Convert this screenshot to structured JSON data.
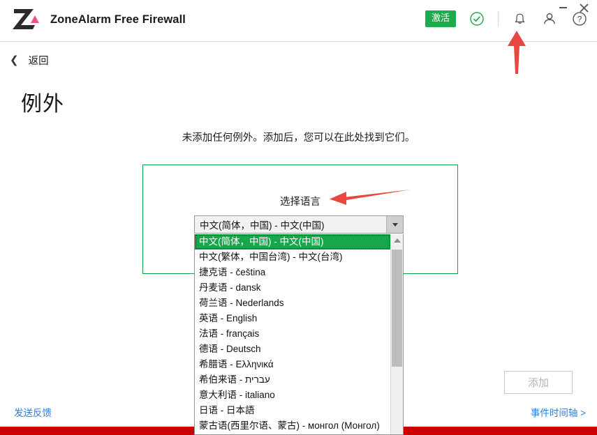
{
  "window": {
    "app_title": "ZoneAlarm Free Firewall",
    "minimize_label": "",
    "close_label": "✕"
  },
  "header": {
    "activate_label": "激活",
    "status_icon": "check-circle-icon",
    "notifications_icon": "bell-icon",
    "account_icon": "person-icon",
    "help_icon": "help-icon",
    "accent_green": "#1faa4d"
  },
  "nav": {
    "back_label": "返回",
    "back_icon": "chevron-left-icon"
  },
  "page": {
    "title": "例外",
    "empty_message": "未添加任何例外。添加后，您可以在此处找到它们。"
  },
  "language_panel": {
    "heading": "选择语言",
    "panel_border_color": "#13a04a",
    "combo_value": "中文(简体，中国) - 中文(中国)",
    "combo_arrow_icon": "chevron-down-icon",
    "selected_index": 0,
    "highlight_color": "#14a84b",
    "options": [
      "中文(简体，中国) - 中文(中国)",
      "中文(繁体，中国台湾) - 中文(台湾)",
      "捷克语 - čeština",
      "丹麦语 - dansk",
      "荷兰语 - Nederlands",
      "英语 - English",
      "法语 - français",
      "德语 - Deutsch",
      "希腊语 - Ελληνικά",
      "希伯来语 - עברית",
      "意大利语 - italiano",
      "日语 - 日本語",
      "蒙古语(西里尔语、蒙古) - монгол (Монгол)"
    ]
  },
  "annotations": {
    "arrow_color": "#e8483f",
    "arrow_language_target": "选择语言",
    "arrow_account_target": "person-icon"
  },
  "footer": {
    "add_label": "添加",
    "feedback_label": "发送反馈",
    "timeline_label": "事件时间轴 >",
    "bottom_bar_color": "#cc0000"
  }
}
